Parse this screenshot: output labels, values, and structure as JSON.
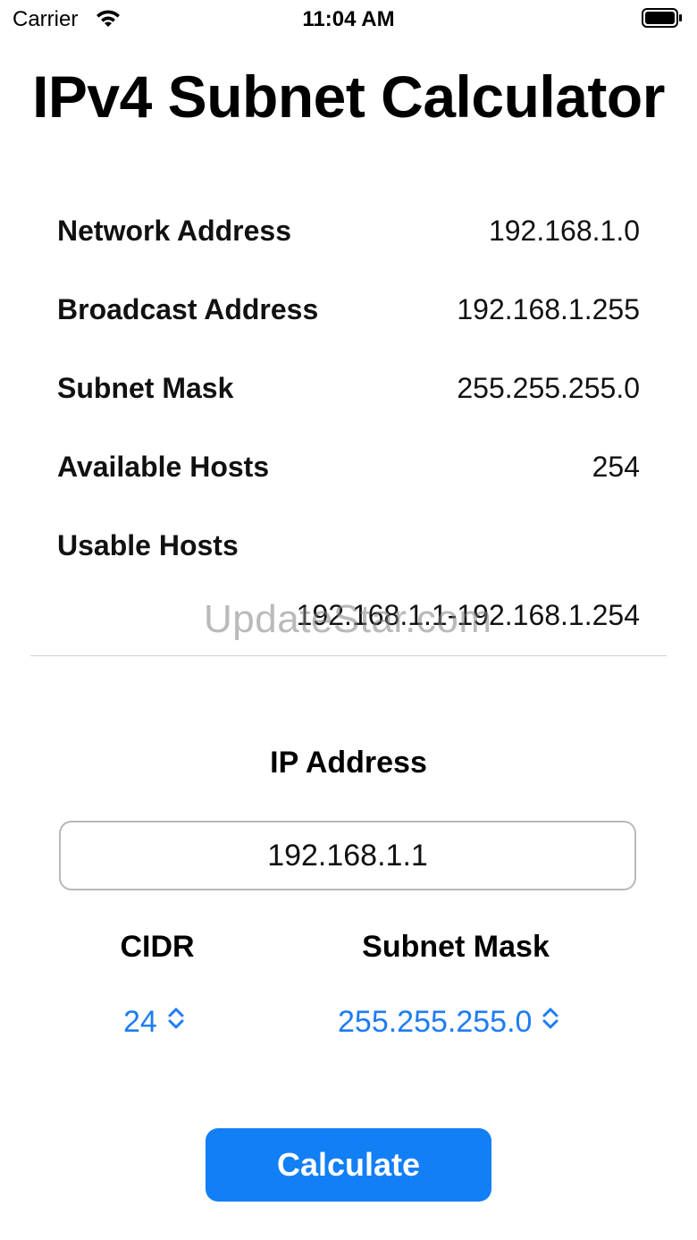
{
  "status_bar": {
    "carrier": "Carrier",
    "time": "11:04 AM",
    "icons": [
      "wifi-icon",
      "battery-icon"
    ]
  },
  "title": "IPv4 Subnet Calculator",
  "results": {
    "network_address": {
      "label": "Network Address",
      "value": "192.168.1.0"
    },
    "broadcast_address": {
      "label": "Broadcast Address",
      "value": "192.168.1.255"
    },
    "subnet_mask": {
      "label": "Subnet Mask",
      "value": "255.255.255.0"
    },
    "available_hosts": {
      "label": "Available Hosts",
      "value": "254"
    },
    "usable_hosts": {
      "label": "Usable Hosts",
      "value": "192.168.1.1-192.168.1.254"
    }
  },
  "watermark": "UpdateStar.com",
  "ip_section": {
    "title": "IP Address",
    "input_value": "192.168.1.1"
  },
  "cidr": {
    "label": "CIDR",
    "value": "24",
    "icon": "chevron-updown-icon"
  },
  "mask": {
    "label": "Subnet Mask",
    "value": "255.255.255.0",
    "icon": "chevron-updown-icon"
  },
  "calculate_label": "Calculate",
  "colors": {
    "accent": "#127ff5",
    "picker_text": "#1e7cf2",
    "divider": "#cfcfcf"
  }
}
